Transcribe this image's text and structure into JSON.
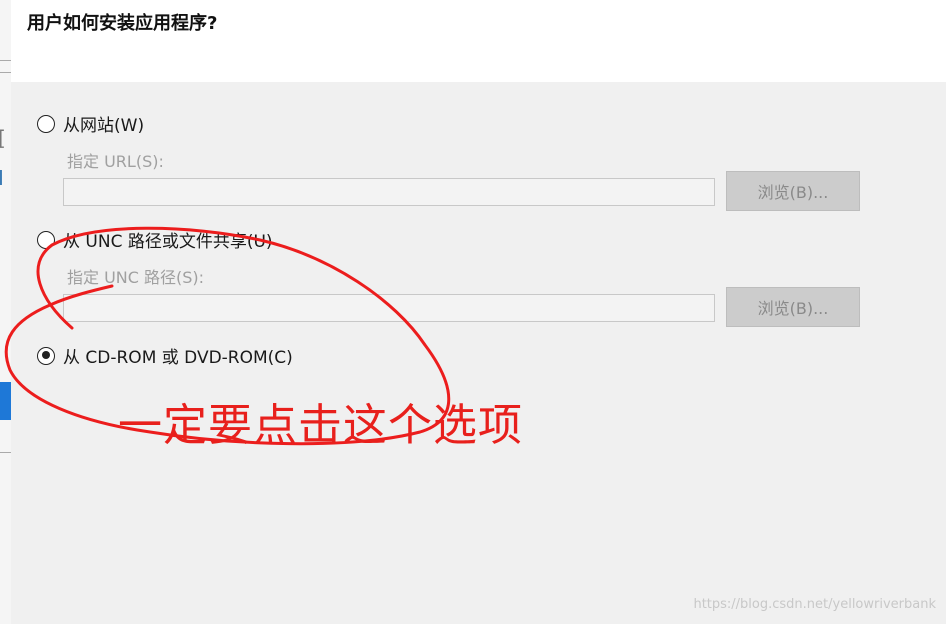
{
  "dialog": {
    "title": "用户如何安装应用程序?"
  },
  "options": [
    {
      "label": "从网站(W)",
      "checked": false,
      "field_label": "指定 URL(S):",
      "field_value": "",
      "browse_label": "浏览(B)..."
    },
    {
      "label": "从 UNC 路径或文件共享(U)",
      "checked": false,
      "field_label": "指定 UNC 路径(S):",
      "field_value": "",
      "browse_label": "浏览(B)..."
    },
    {
      "label": "从 CD-ROM 或 DVD-ROM(C)",
      "checked": true
    }
  ],
  "annotation": {
    "text": "一定要点击这个选项",
    "color": "#e8201c"
  },
  "watermark": "https://blog.csdn.net/yellowriverbank"
}
